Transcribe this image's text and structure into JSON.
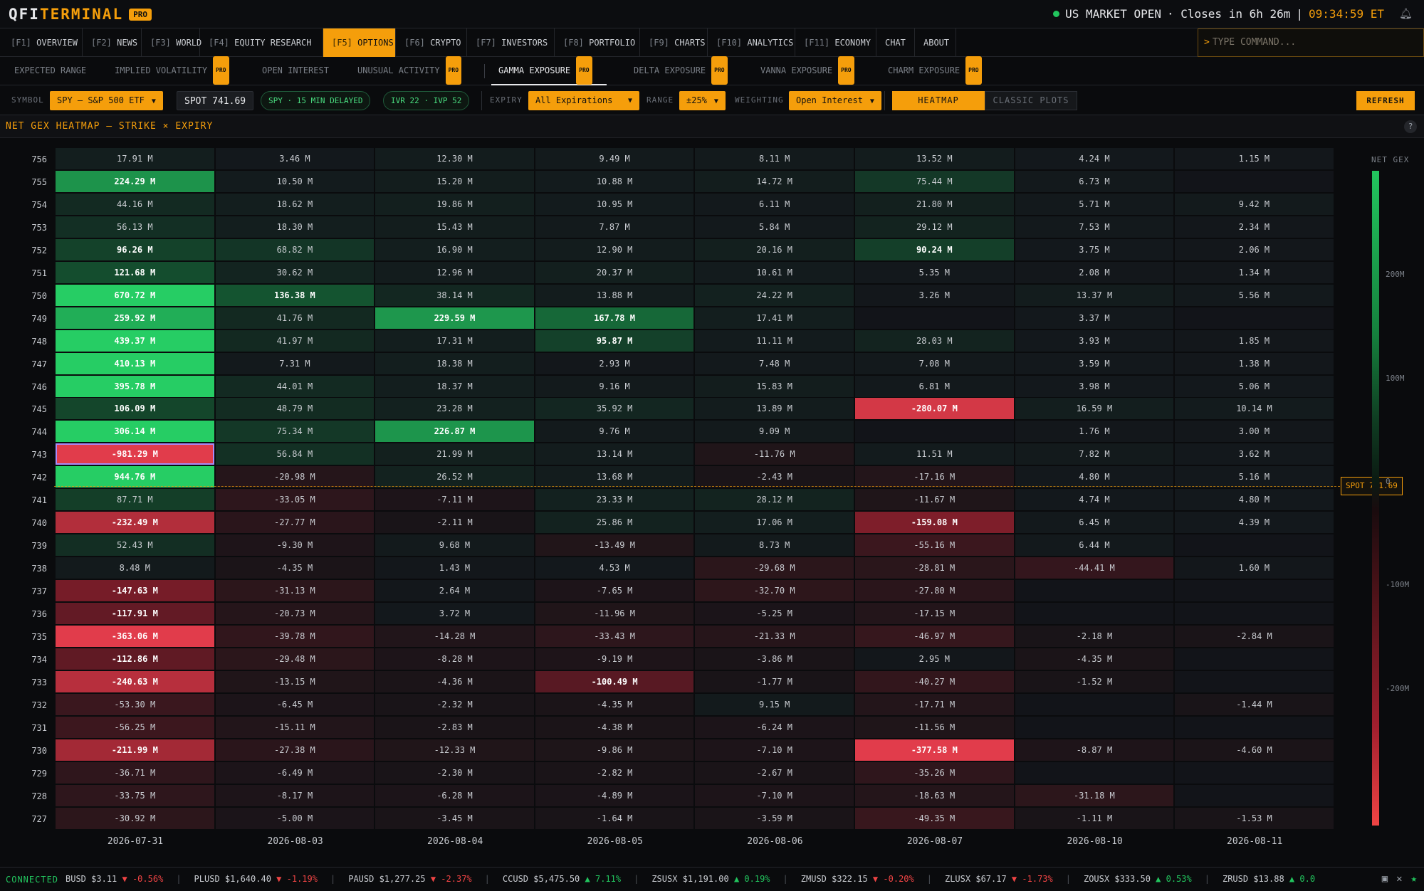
{
  "app": {
    "brand_a": "QFI",
    "brand_b": "TERMINAL",
    "pro": "PRO"
  },
  "market": {
    "status": "US MARKET OPEN",
    "closes": "· Closes in 6h 26m",
    "sep": "|",
    "time": "09:34:59 ET"
  },
  "nav": {
    "items": [
      {
        "key": "[F1]",
        "label": "OVERVIEW"
      },
      {
        "key": "[F2]",
        "label": "NEWS"
      },
      {
        "key": "[F3]",
        "label": "WORLD"
      },
      {
        "key": "[F4]",
        "label": "EQUITY RESEARCH"
      },
      {
        "key": "[F5]",
        "label": "OPTIONS"
      },
      {
        "key": "[F6]",
        "label": "CRYPTO"
      },
      {
        "key": "[F7]",
        "label": "INVESTORS"
      },
      {
        "key": "[F8]",
        "label": "PORTFOLIO"
      },
      {
        "key": "[F9]",
        "label": "CHARTS"
      },
      {
        "key": "[F10]",
        "label": "ANALYTICS"
      },
      {
        "key": "[F11]",
        "label": "ECONOMY"
      },
      {
        "key": "",
        "label": "CHAT"
      },
      {
        "key": "",
        "label": "ABOUT"
      }
    ],
    "command_placeholder": "TYPE COMMAND..."
  },
  "subnav": {
    "items": [
      {
        "label": "EXPECTED RANGE",
        "pro": false
      },
      {
        "label": "IMPLIED VOLATILITY",
        "pro": true
      },
      {
        "label": "OPEN INTEREST",
        "pro": false
      },
      {
        "label": "UNUSUAL ACTIVITY",
        "pro": true
      },
      {
        "label": "GAMMA EXPOSURE",
        "pro": true
      },
      {
        "label": "DELTA EXPOSURE",
        "pro": true
      },
      {
        "label": "VANNA EXPOSURE",
        "pro": true
      },
      {
        "label": "CHARM EXPOSURE",
        "pro": true
      }
    ]
  },
  "controls": {
    "symbol_label": "SYMBOL",
    "symbol_value": "SPY — S&P 500 ETF",
    "spot": "SPOT 741.69",
    "delayed": "SPY · 15 MIN DELAYED",
    "ivr": "IVR 22 · IVP 52",
    "expiry_label": "EXPIRY",
    "expiry_value": "All Expirations",
    "range_label": "RANGE",
    "range_value": "±25%",
    "weighting_label": "WEIGHTING",
    "weighting_value": "Open Interest",
    "heatmap": "HEATMAP",
    "classic": "CLASSIC PLOTS",
    "refresh": "REFRESH"
  },
  "panel": {
    "title": "NET GEX HEATMAP — STRIKE × EXPIRY",
    "help": "?"
  },
  "chart_data": {
    "type": "heatmap",
    "title": "NET GEX HEATMAP — STRIKE × EXPIRY",
    "legend_title": "NET GEX",
    "unit": "M",
    "spot": 741.69,
    "spot_label": "SPOT 741.69",
    "color_range": [
      -300,
      300
    ],
    "legend_ticks": [
      {
        "v": 200,
        "label": "200M"
      },
      {
        "v": 100,
        "label": "100M"
      },
      {
        "v": 0,
        "label": "0"
      },
      {
        "v": -100,
        "label": "-100M"
      },
      {
        "v": -200,
        "label": "-200M"
      }
    ],
    "expiries": [
      "2026-07-31",
      "2026-08-03",
      "2026-08-04",
      "2026-08-05",
      "2026-08-06",
      "2026-08-07",
      "2026-08-10",
      "2026-08-11"
    ],
    "strikes": [
      756,
      755,
      754,
      753,
      752,
      751,
      750,
      749,
      748,
      747,
      746,
      745,
      744,
      743,
      742,
      741,
      740,
      739,
      738,
      737,
      736,
      735,
      734,
      733,
      732,
      731,
      730,
      729,
      728,
      727
    ],
    "selected": {
      "strike": 743,
      "expiry": "2026-07-31"
    },
    "values": [
      [
        17.91,
        3.46,
        12.3,
        9.49,
        8.11,
        13.52,
        4.24,
        1.15
      ],
      [
        224.29,
        10.5,
        15.2,
        10.88,
        14.72,
        75.44,
        6.73,
        null
      ],
      [
        44.16,
        18.62,
        19.86,
        10.95,
        6.11,
        21.8,
        5.71,
        9.42
      ],
      [
        56.13,
        18.3,
        15.43,
        7.87,
        5.84,
        29.12,
        7.53,
        2.34
      ],
      [
        96.26,
        68.82,
        16.9,
        12.9,
        20.16,
        90.24,
        3.75,
        2.06
      ],
      [
        121.68,
        30.62,
        12.96,
        20.37,
        10.61,
        5.35,
        2.08,
        1.34
      ],
      [
        670.72,
        136.38,
        38.14,
        13.88,
        24.22,
        3.26,
        13.37,
        5.56
      ],
      [
        259.92,
        41.76,
        229.59,
        167.78,
        17.41,
        null,
        3.37,
        null
      ],
      [
        439.37,
        41.97,
        17.31,
        95.87,
        11.11,
        28.03,
        3.93,
        1.85
      ],
      [
        410.13,
        7.31,
        18.38,
        2.93,
        7.48,
        7.08,
        3.59,
        1.38
      ],
      [
        395.78,
        44.01,
        18.37,
        9.16,
        15.83,
        6.81,
        3.98,
        5.06
      ],
      [
        106.09,
        48.79,
        23.28,
        35.92,
        13.89,
        -280.07,
        16.59,
        10.14
      ],
      [
        306.14,
        75.34,
        226.87,
        9.76,
        9.09,
        null,
        1.76,
        3.0
      ],
      [
        -981.29,
        56.84,
        21.99,
        13.14,
        -11.76,
        11.51,
        7.82,
        3.62
      ],
      [
        944.76,
        -20.98,
        26.52,
        13.68,
        -2.43,
        -17.16,
        4.8,
        5.16
      ],
      [
        87.71,
        -33.05,
        -7.11,
        23.33,
        28.12,
        -11.67,
        4.74,
        4.8
      ],
      [
        -232.49,
        -27.77,
        -2.11,
        25.86,
        17.06,
        -159.08,
        6.45,
        4.39
      ],
      [
        52.43,
        -9.3,
        9.68,
        -13.49,
        8.73,
        -55.16,
        6.44,
        null
      ],
      [
        8.48,
        -4.35,
        1.43,
        4.53,
        -29.68,
        -28.81,
        -44.41,
        1.6
      ],
      [
        -147.63,
        -31.13,
        2.64,
        -7.65,
        -32.7,
        -27.8,
        null,
        null
      ],
      [
        -117.91,
        -20.73,
        3.72,
        -11.96,
        -5.25,
        -17.15,
        null,
        null
      ],
      [
        -363.06,
        -39.78,
        -14.28,
        -33.43,
        -21.33,
        -46.97,
        -2.18,
        -2.84
      ],
      [
        -112.86,
        -29.48,
        -8.28,
        -9.19,
        -3.86,
        2.95,
        -4.35,
        null
      ],
      [
        -240.63,
        -13.15,
        -4.36,
        -100.49,
        -1.77,
        -40.27,
        -1.52,
        null
      ],
      [
        -53.3,
        -6.45,
        -2.32,
        -4.35,
        9.15,
        -17.71,
        null,
        -1.44
      ],
      [
        -56.25,
        -15.11,
        -2.83,
        -4.38,
        -6.24,
        -11.56,
        null,
        null
      ],
      [
        -211.99,
        -27.38,
        -12.33,
        -9.86,
        -7.1,
        -377.58,
        -8.87,
        -4.6
      ],
      [
        -36.71,
        -6.49,
        -2.3,
        -2.82,
        -2.67,
        -35.26,
        null,
        null
      ],
      [
        -33.75,
        -8.17,
        -6.28,
        -4.89,
        -7.1,
        -18.63,
        -31.18,
        null
      ],
      [
        -30.92,
        -5.0,
        -3.45,
        -1.64,
        -3.59,
        -49.35,
        -1.11,
        -1.53
      ]
    ]
  },
  "footer": {
    "status": "CONNECTED",
    "ticker": [
      {
        "sym": "BUSD",
        "price": "$3.11",
        "chg": "-0.56%",
        "dir": "down"
      },
      {
        "sym": "PLUSD",
        "price": "$1,640.40",
        "chg": "-1.19%",
        "dir": "down"
      },
      {
        "sym": "PAUSD",
        "price": "$1,277.25",
        "chg": "-2.37%",
        "dir": "down"
      },
      {
        "sym": "CCUSD",
        "price": "$5,475.50",
        "chg": "7.11%",
        "dir": "up"
      },
      {
        "sym": "ZSUSX",
        "price": "$1,191.00",
        "chg": "0.19%",
        "dir": "up"
      },
      {
        "sym": "ZMUSD",
        "price": "$322.15",
        "chg": "-0.20%",
        "dir": "down"
      },
      {
        "sym": "ZLUSX",
        "price": "$67.17",
        "chg": "-1.73%",
        "dir": "down"
      },
      {
        "sym": "ZOUSX",
        "price": "$333.50",
        "chg": "0.53%",
        "dir": "up"
      },
      {
        "sym": "ZRUSD",
        "price": "$13.88",
        "chg": "0.0",
        "dir": "up"
      }
    ],
    "icons": [
      "instagram-icon",
      "x-icon",
      "star-icon"
    ]
  }
}
